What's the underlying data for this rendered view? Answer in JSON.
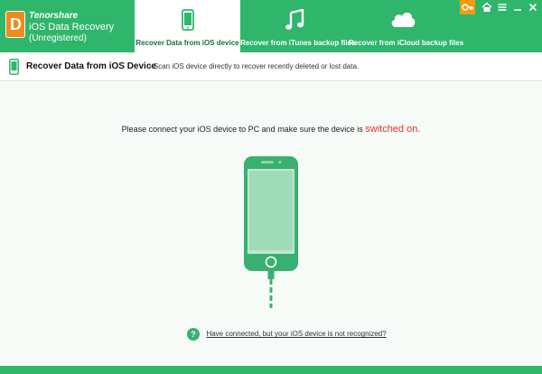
{
  "brand": {
    "company": "Tenorshare",
    "product": "iOS Data Recovery",
    "status": "(Unregistered)",
    "logo_letter": "D"
  },
  "tabs": [
    {
      "label": "Recover Data from iOS device",
      "icon": "phone-icon",
      "active": true
    },
    {
      "label": "Recover from iTunes backup files",
      "icon": "music-note-icon",
      "active": false
    },
    {
      "label": "Recover from iCloud backup files",
      "icon": "cloud-icon",
      "active": false
    }
  ],
  "subheader": {
    "title": "Recover Data from iOS Device",
    "description": "- Scan iOS device directly to recover recently deleted or lost data."
  },
  "main": {
    "instruction": "Please connect your iOS device to PC and make sure the device is",
    "instruction_highlight": "switched on",
    "instruction_end": ".",
    "help_link": "Have connected, but your iOS device is not recognized?"
  },
  "colors": {
    "brand_green": "#2fb66b",
    "phone_green": "#3ab070",
    "highlight_red": "#e33030",
    "key_orange": "#f29b12"
  }
}
